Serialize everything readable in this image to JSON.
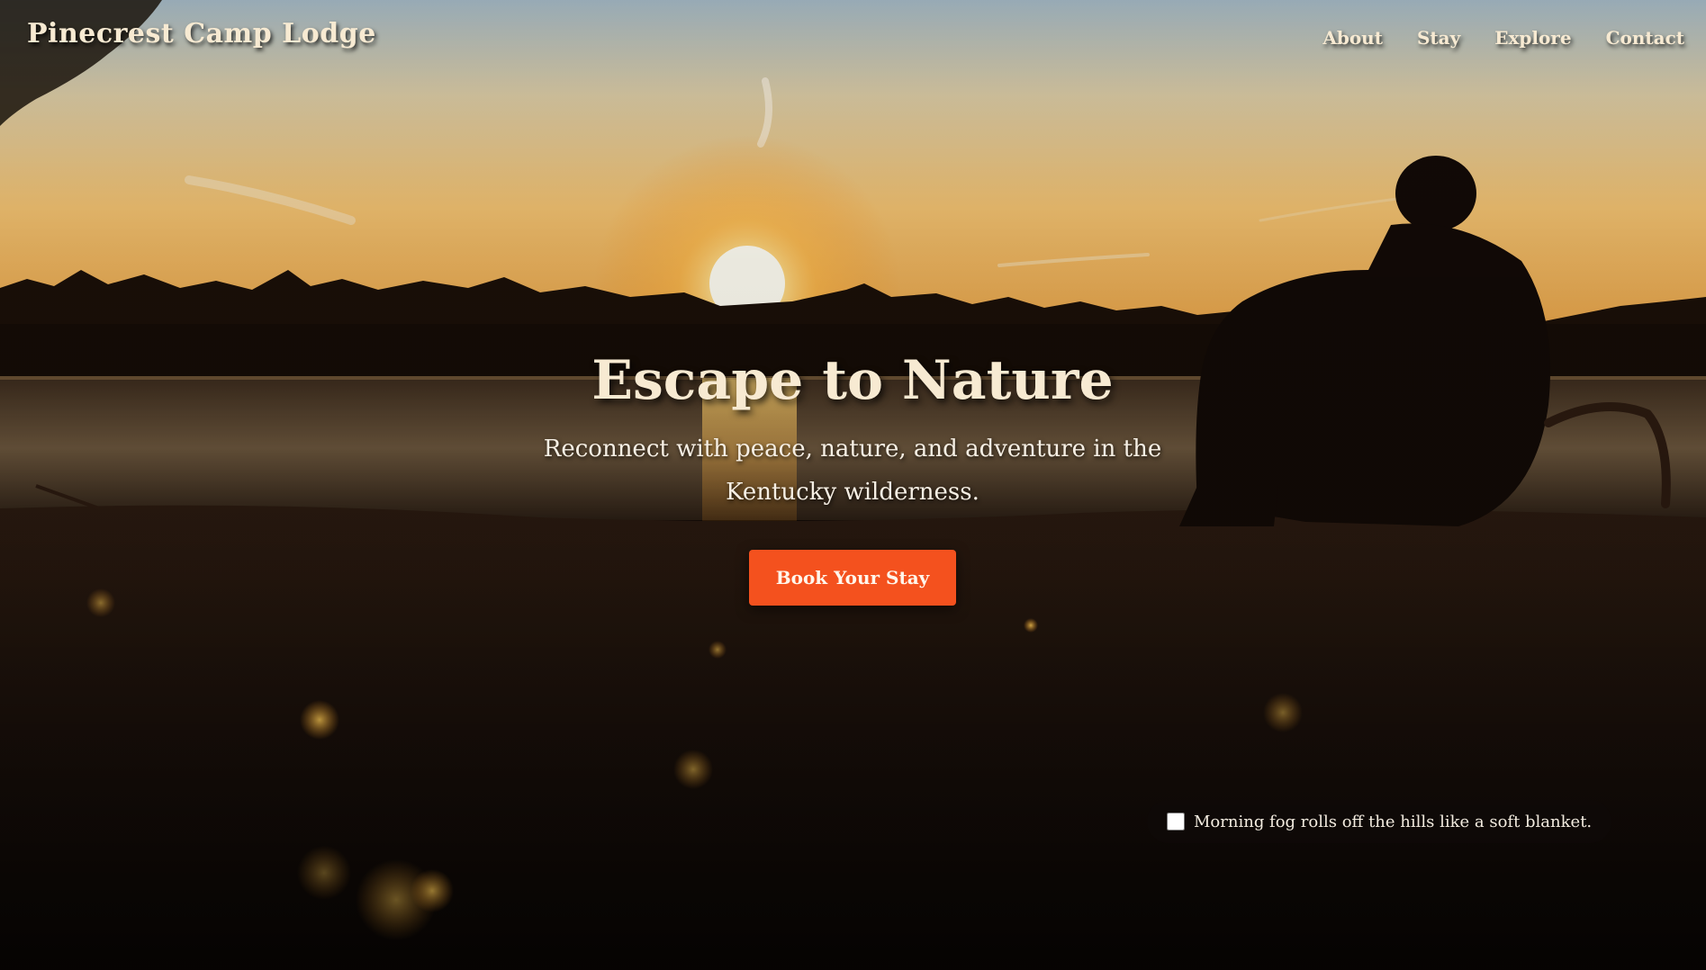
{
  "nav": {
    "logo": "Pinecrest Camp Lodge",
    "links": [
      "About",
      "Stay",
      "Explore",
      "Contact"
    ]
  },
  "hero": {
    "title": "Escape to Nature",
    "subtitle": "Reconnect with peace, nature, and adventure in the Kentucky wilderness.",
    "cta_label": "Book Your Stay",
    "background_icon": "sunset-lake-silhouette-photo"
  },
  "tip": {
    "text": "Morning fog rolls off the hills like a soft blanket.",
    "checked": false
  },
  "colors": {
    "accent": "#f4511e",
    "heading_text": "#f7ead2",
    "body_text": "#f6efe4"
  }
}
